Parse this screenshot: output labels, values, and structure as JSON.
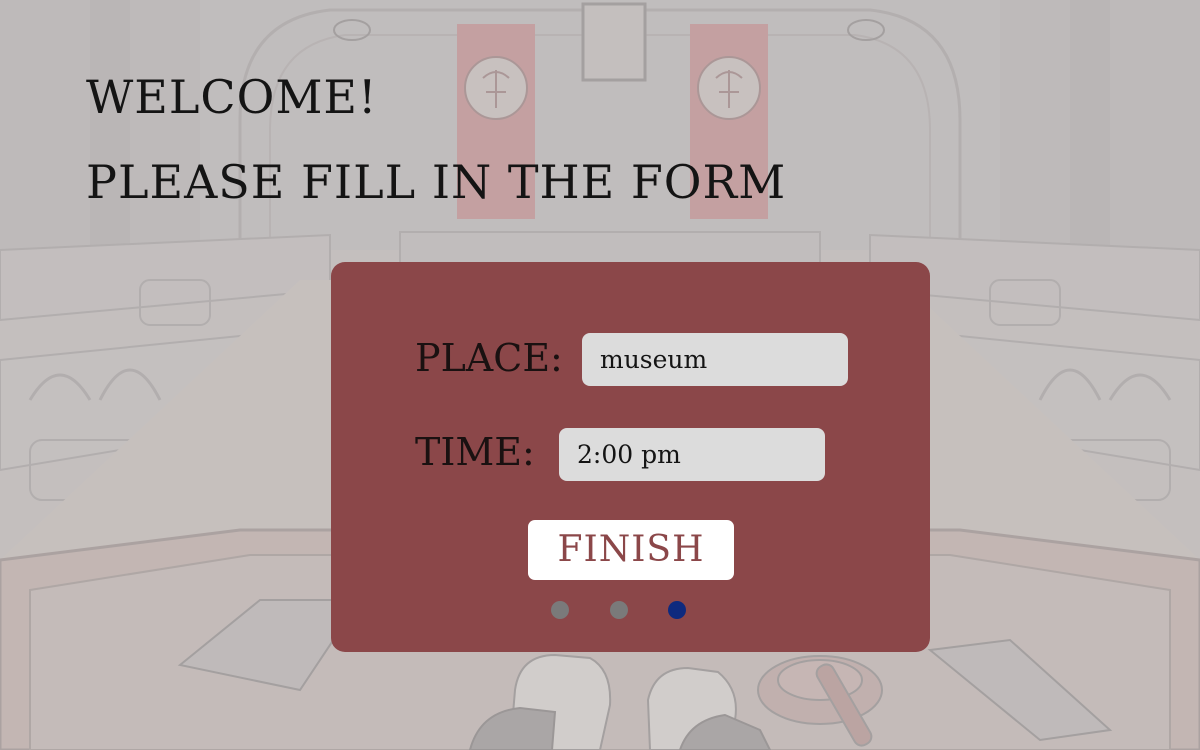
{
  "header": {
    "welcome": "WELCOME!",
    "instructions": "PLEASE FILL IN THE FORM"
  },
  "form": {
    "place_label": "PLACE:",
    "place_value": "museum",
    "time_label": "TIME:",
    "time_value": "2:00 pm",
    "finish_label": "FINISH"
  },
  "pagination": {
    "total": 3,
    "current": 3
  },
  "colors": {
    "card": "#8b4749",
    "field": "#dcdcdc",
    "dot_inactive": "#7a7a7a",
    "dot_active": "#0e2a7e",
    "banner": "#c98a8c",
    "overlay": "#bebbbb"
  }
}
